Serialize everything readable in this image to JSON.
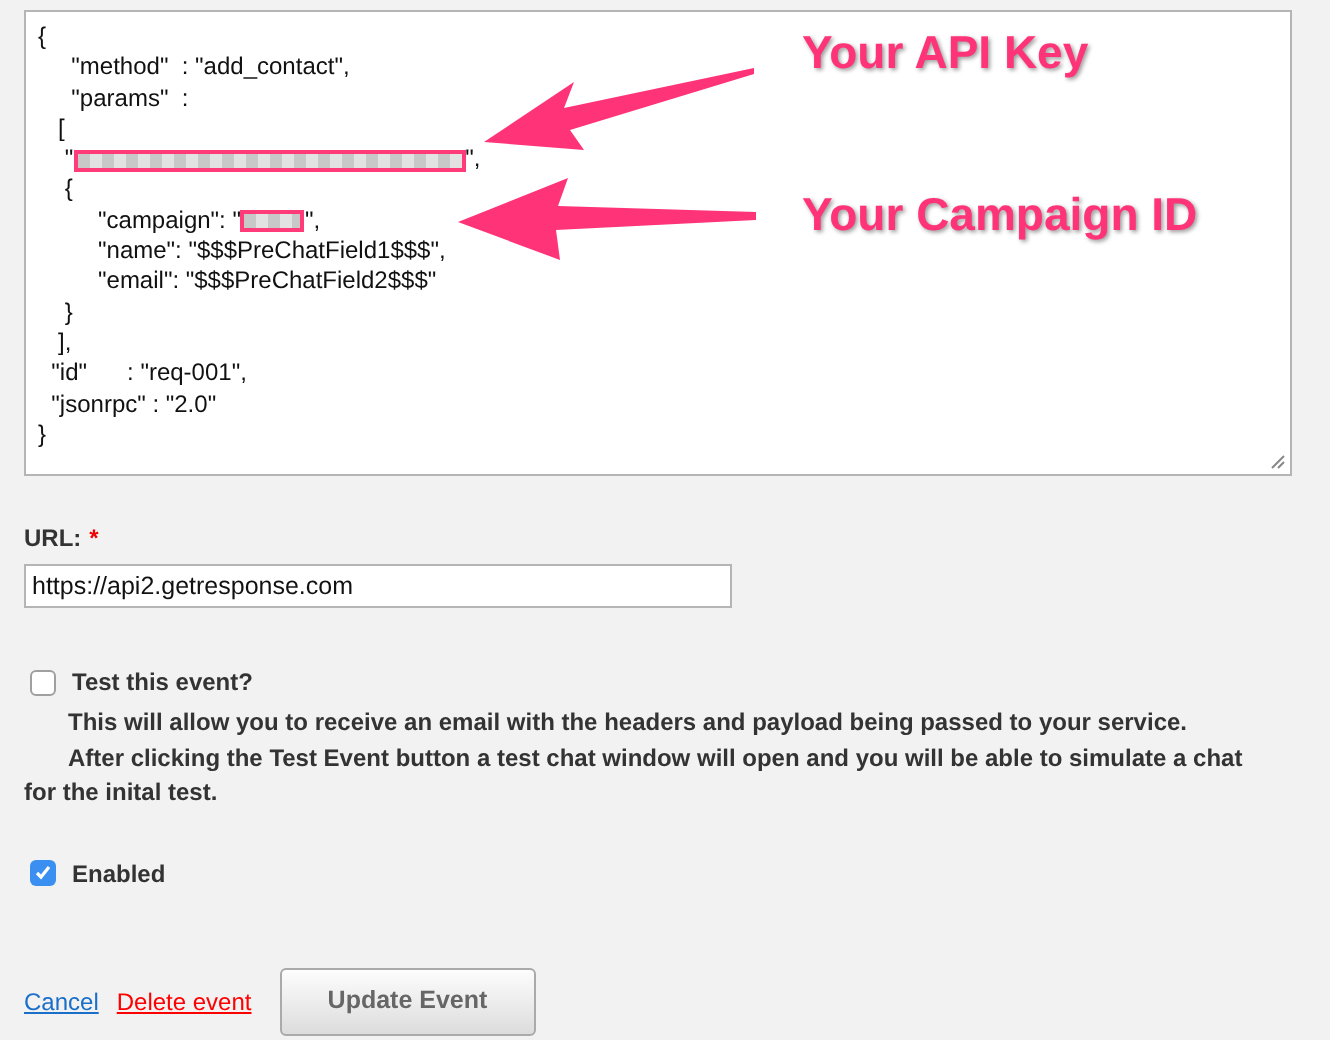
{
  "payload_editor": {
    "lines": [
      [
        {
          "kind": "text",
          "text": "{"
        }
      ],
      [
        {
          "kind": "text",
          "text": "     \"method\"  : \"add_contact\","
        }
      ],
      [
        {
          "kind": "text",
          "text": "     \"params\"  :"
        }
      ],
      [
        {
          "kind": "text",
          "text": "   ["
        }
      ],
      [
        {
          "kind": "text",
          "text": "    \""
        },
        {
          "kind": "redacted"
        },
        {
          "kind": "text",
          "text": "\","
        }
      ],
      [
        {
          "kind": "text",
          "text": "    {"
        }
      ],
      [
        {
          "kind": "text",
          "text": "         \"campaign\": \""
        },
        {
          "kind": "redacted-short"
        },
        {
          "kind": "text",
          "text": "\","
        }
      ],
      [
        {
          "kind": "text",
          "text": "         \"name\": \"$$$PreChatField1$$$\","
        }
      ],
      [
        {
          "kind": "text",
          "text": "         \"email\": \"$$$PreChatField2$$$\""
        }
      ],
      [
        {
          "kind": "text",
          "text": "    }"
        }
      ],
      [
        {
          "kind": "text",
          "text": "   ],"
        }
      ],
      [
        {
          "kind": "text",
          "text": "  \"id\"      : \"req-001\","
        }
      ],
      [
        {
          "kind": "text",
          "text": "  \"jsonrpc\" : \"2.0\""
        }
      ],
      [
        {
          "kind": "text",
          "text": "}"
        }
      ]
    ],
    "annotations": [
      {
        "text": "Your API Key"
      },
      {
        "text": "Your Campaign ID"
      }
    ]
  },
  "url_field": {
    "label": "URL:",
    "required_mark": "*",
    "value": "https://api2.getresponse.com"
  },
  "test_event": {
    "checked": false,
    "label": "Test this event?",
    "description": [
      "This will allow you to receive an email with the headers and payload being passed to your service.",
      "After clicking the Test Event button a test chat window will open and you will be able to simulate a chat for the inital test."
    ]
  },
  "enabled": {
    "checked": true,
    "label": "Enabled"
  },
  "actions": {
    "cancel": "Cancel",
    "delete": "Delete event",
    "update": "Update Event"
  }
}
